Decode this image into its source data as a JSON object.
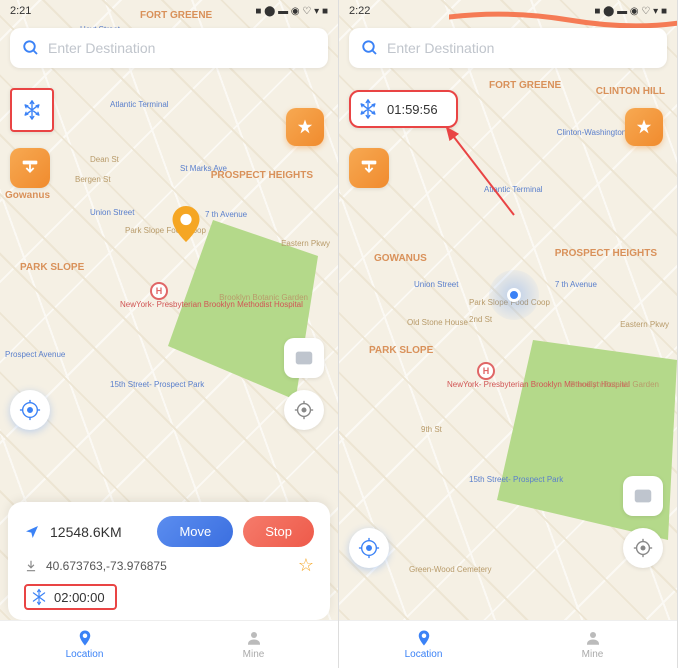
{
  "left": {
    "status_bar": {
      "time": "2:21",
      "indicators": "■ ⬤ ▬  ◉ ♡ ▾ ■"
    },
    "search": {
      "placeholder": "Enter Destination"
    },
    "panel": {
      "distance": "12548.6KM",
      "move_label": "Move",
      "stop_label": "Stop",
      "coords": "40.673763,-73.976875",
      "timer": "02:00:00"
    },
    "nav": {
      "location": "Location",
      "mine": "Mine"
    },
    "map_labels": {
      "fort_greene": "FORT GREENE",
      "hoyt": "Hoyt Street",
      "atlantic_terminal": "Atlantic Terminal",
      "dean": "Dean St",
      "bergen": "Bergen St",
      "gowanus": "Gowanus",
      "union": "Union Street",
      "park_slope": "PARK SLOPE",
      "park_slope_food": "Park Slope Food Coop",
      "seventh": "7 th Avenue",
      "prospect_heights": "PROSPECT HEIGHTS",
      "hospital": "NewYork-\nPresbyterian Brooklyn\nMethodist Hospital",
      "botanic": "Brooklyn\nBotanic Garden",
      "fifteenth": "15th Street-\nProspect Park",
      "prospect_ave": "Prospect Avenue",
      "eastern": "Eastern Pkwy"
    }
  },
  "right": {
    "status_bar": {
      "time": "2:22",
      "indicators": "■ ⬤ ▬  ◉ ♡ ▾ ■"
    },
    "search": {
      "placeholder": "Enter Destination"
    },
    "timer_badge": "01:59:56",
    "nav": {
      "location": "Location",
      "mine": "Mine"
    },
    "map_labels": {
      "fort_greene": "FORT GREENE",
      "clinton": "CLINTON HILL",
      "clinton_wash": "Clinton-Washington\nAvenues",
      "atlantic_terminal": "Atlantic Terminal",
      "gowanus": "GOWANUS",
      "union": "Union Street",
      "park_slope": "PARK SLOPE",
      "park_slope_food": "Park Slope Food Coop",
      "seventh": "7 th Avenue",
      "prospect_heights": "PROSPECT HEIGHTS",
      "hospital": "NewYork-\nPresbyterian Brooklyn\nMethodist Hospital",
      "botanic": "Brooklyn\nBotanic Garden",
      "fifteenth": "15th Street-\nProspect Park",
      "greenwood": "Green-Wood Cemetery",
      "eastern": "Eastern Pkwy",
      "old_stone": "Old Stone House",
      "second": "2nd St",
      "ninth": "9th St"
    }
  },
  "icons": {
    "snowflake": "snowflake-icon",
    "star": "star-icon",
    "import": "import-icon",
    "gamepad": "gamepad-icon",
    "target": "target-icon",
    "compass": "compass-icon",
    "search": "search-icon",
    "nav_arrow": "nav-arrow-icon",
    "download": "download-icon",
    "location_tab": "location-tab-icon",
    "mine_tab": "mine-tab-icon"
  }
}
